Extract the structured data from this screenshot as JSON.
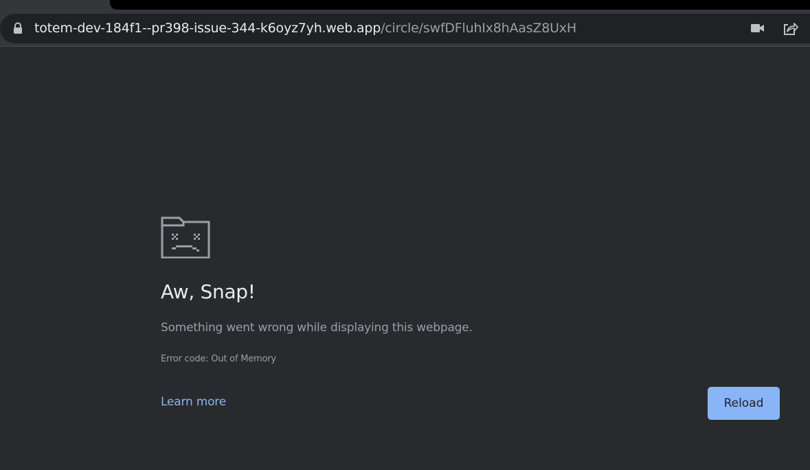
{
  "browser": {
    "url_host": "totem-dev-184f1--pr398-issue-344-k6oyz7yh.web.app",
    "url_path": "/circle/swfDFluhIx8hAasZ8UxH",
    "icons": {
      "lock": "lock-icon",
      "camera": "camera-icon",
      "share": "share-icon"
    }
  },
  "error_page": {
    "icon": "sad-tab-icon",
    "title": "Aw, Snap!",
    "message": "Something went wrong while displaying this webpage.",
    "error_code": "Error code: Out of Memory",
    "learn_more_label": "Learn more",
    "reload_label": "Reload"
  },
  "colors": {
    "background": "#292a2d",
    "accent": "#8ab4f8",
    "text_primary": "#e8eaed",
    "text_secondary": "#9aa0a6"
  }
}
